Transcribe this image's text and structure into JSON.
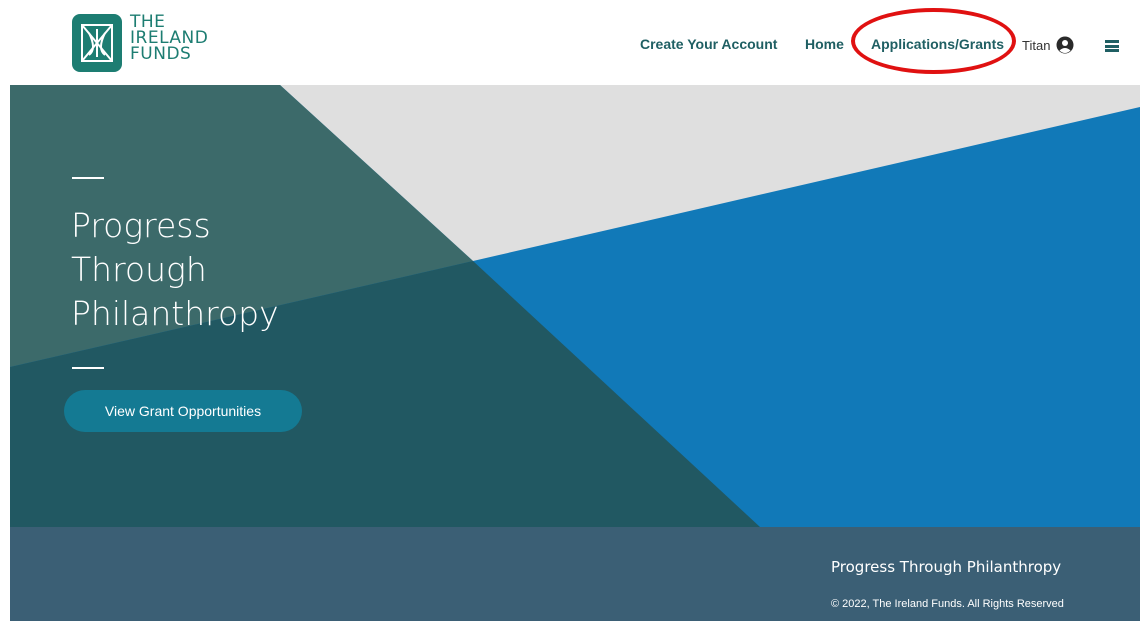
{
  "brand": {
    "logo_lines": [
      "THE",
      "IRELAND",
      "FUNDS"
    ],
    "color": "#1d7d72"
  },
  "nav": {
    "create_account": "Create Your Account",
    "home": "Home",
    "applications_grants": "Applications/Grants"
  },
  "user": {
    "name": "Titan",
    "icon": "user-circle-icon"
  },
  "menu": {
    "icon": "hamburger-menu-icon"
  },
  "hero": {
    "headline_lines": [
      "Progress",
      "Through",
      "Philanthropy"
    ],
    "cta_label": "View Grant Opportunities",
    "colors": {
      "light_gray": "#dfdfdf",
      "blue": "#1179b8",
      "light_teal": "#3c6a6a",
      "dark_teal": "#215862",
      "button": "#147a93"
    }
  },
  "annotation": {
    "color": "#e01111"
  },
  "footer": {
    "tagline": "Progress Through Philanthropy",
    "copyright": "© 2022, The Ireland Funds. All Rights Reserved",
    "background": "#3b5f75"
  }
}
